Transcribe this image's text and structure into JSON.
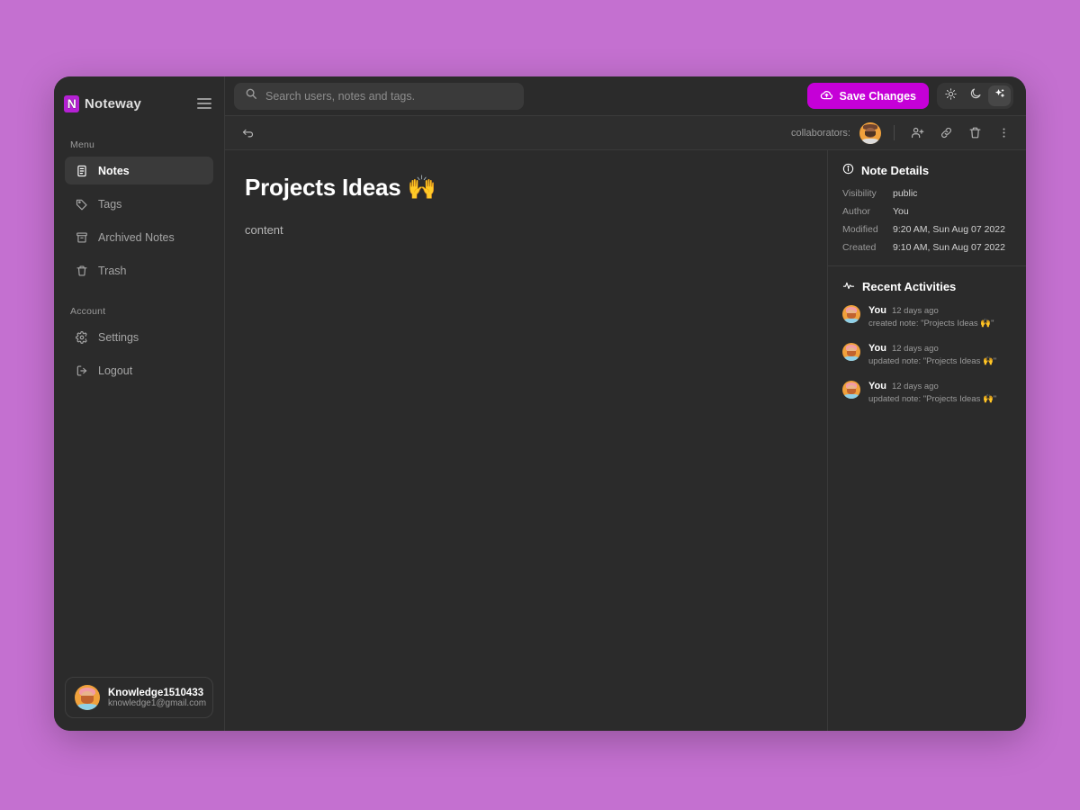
{
  "app": {
    "brand_badge": "N",
    "brand_name": "Noteway"
  },
  "sidebar": {
    "menu_label": "Menu",
    "account_label": "Account",
    "menu_items": [
      {
        "label": "Notes",
        "icon": "note-icon",
        "active": true
      },
      {
        "label": "Tags",
        "icon": "tag-icon",
        "active": false
      },
      {
        "label": "Archived Notes",
        "icon": "archive-icon",
        "active": false
      },
      {
        "label": "Trash",
        "icon": "trash-icon",
        "active": false
      }
    ],
    "account_items": [
      {
        "label": "Settings",
        "icon": "gear-icon"
      },
      {
        "label": "Logout",
        "icon": "logout-icon"
      }
    ],
    "user": {
      "name": "Knowledge1510433",
      "email": "knowledge1@gmail.com"
    }
  },
  "topbar": {
    "search_placeholder": "Search users, notes and tags.",
    "search_value": "",
    "save_label": "Save Changes",
    "theme_modes": [
      {
        "name": "light",
        "icon": "sun-icon",
        "active": false
      },
      {
        "name": "dark",
        "icon": "moon-icon",
        "active": false
      },
      {
        "name": "auto",
        "icon": "sparkles-icon",
        "active": true
      }
    ]
  },
  "note_toolbar": {
    "back_icon": "back-arrow-icon",
    "collaborators_label": "collaborators:",
    "actions": [
      {
        "name": "add-collaborator",
        "icon": "add-user-icon"
      },
      {
        "name": "copy-link",
        "icon": "link-icon"
      },
      {
        "name": "delete-note",
        "icon": "trash-icon"
      },
      {
        "name": "more-options",
        "icon": "more-vertical-icon"
      }
    ]
  },
  "note": {
    "title": "Projects Ideas 🙌",
    "content": "content"
  },
  "details": {
    "heading": "Note Details",
    "rows": [
      {
        "key": "Visibility",
        "value": "public"
      },
      {
        "key": "Author",
        "value": "You"
      },
      {
        "key": "Modified",
        "value": "9:20 AM, Sun Aug 07 2022"
      },
      {
        "key": "Created",
        "value": "9:10 AM, Sun Aug 07 2022"
      }
    ]
  },
  "activities": {
    "heading": "Recent Activities",
    "items": [
      {
        "who": "You",
        "when": "12 days ago",
        "text": "created note: \"Projects Ideas 🙌\""
      },
      {
        "who": "You",
        "when": "12 days ago",
        "text": "updated note: \"Projects Ideas 🙌\""
      },
      {
        "who": "You",
        "when": "12 days ago",
        "text": "updated note: \"Projects Ideas 🙌\""
      }
    ]
  },
  "colors": {
    "page_background": "#c470d0",
    "window_background": "#2b2b2b",
    "accent": "#c500d7",
    "brand_badge": "#b521d4"
  }
}
